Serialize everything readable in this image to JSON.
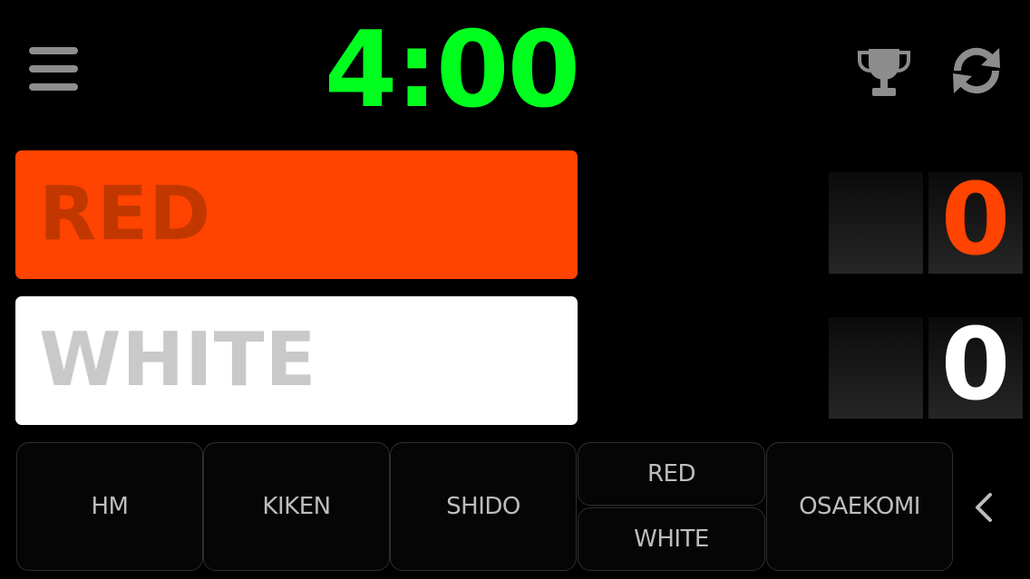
{
  "timer": {
    "display": "4:00",
    "color": "#00ff1e"
  },
  "players": [
    {
      "id": "red",
      "name": "RED",
      "score": "0",
      "bar_color": "#ff4300",
      "score_color": "#ff4300"
    },
    {
      "id": "white",
      "name": "WHITE",
      "score": "0",
      "bar_color": "#ffffff",
      "score_color": "#ffffff"
    }
  ],
  "toolbar": {
    "menu_icon": "hamburger-menu-icon",
    "trophy_icon": "trophy-icon",
    "reset_icon": "refresh-icon"
  },
  "actions": {
    "hm": "HM",
    "kiken": "KIKEN",
    "shido": "SHIDO",
    "red": "RED",
    "white": "WHITE",
    "osaekomi": "OSAEKOMI",
    "more_icon": "chevron-left-icon"
  }
}
